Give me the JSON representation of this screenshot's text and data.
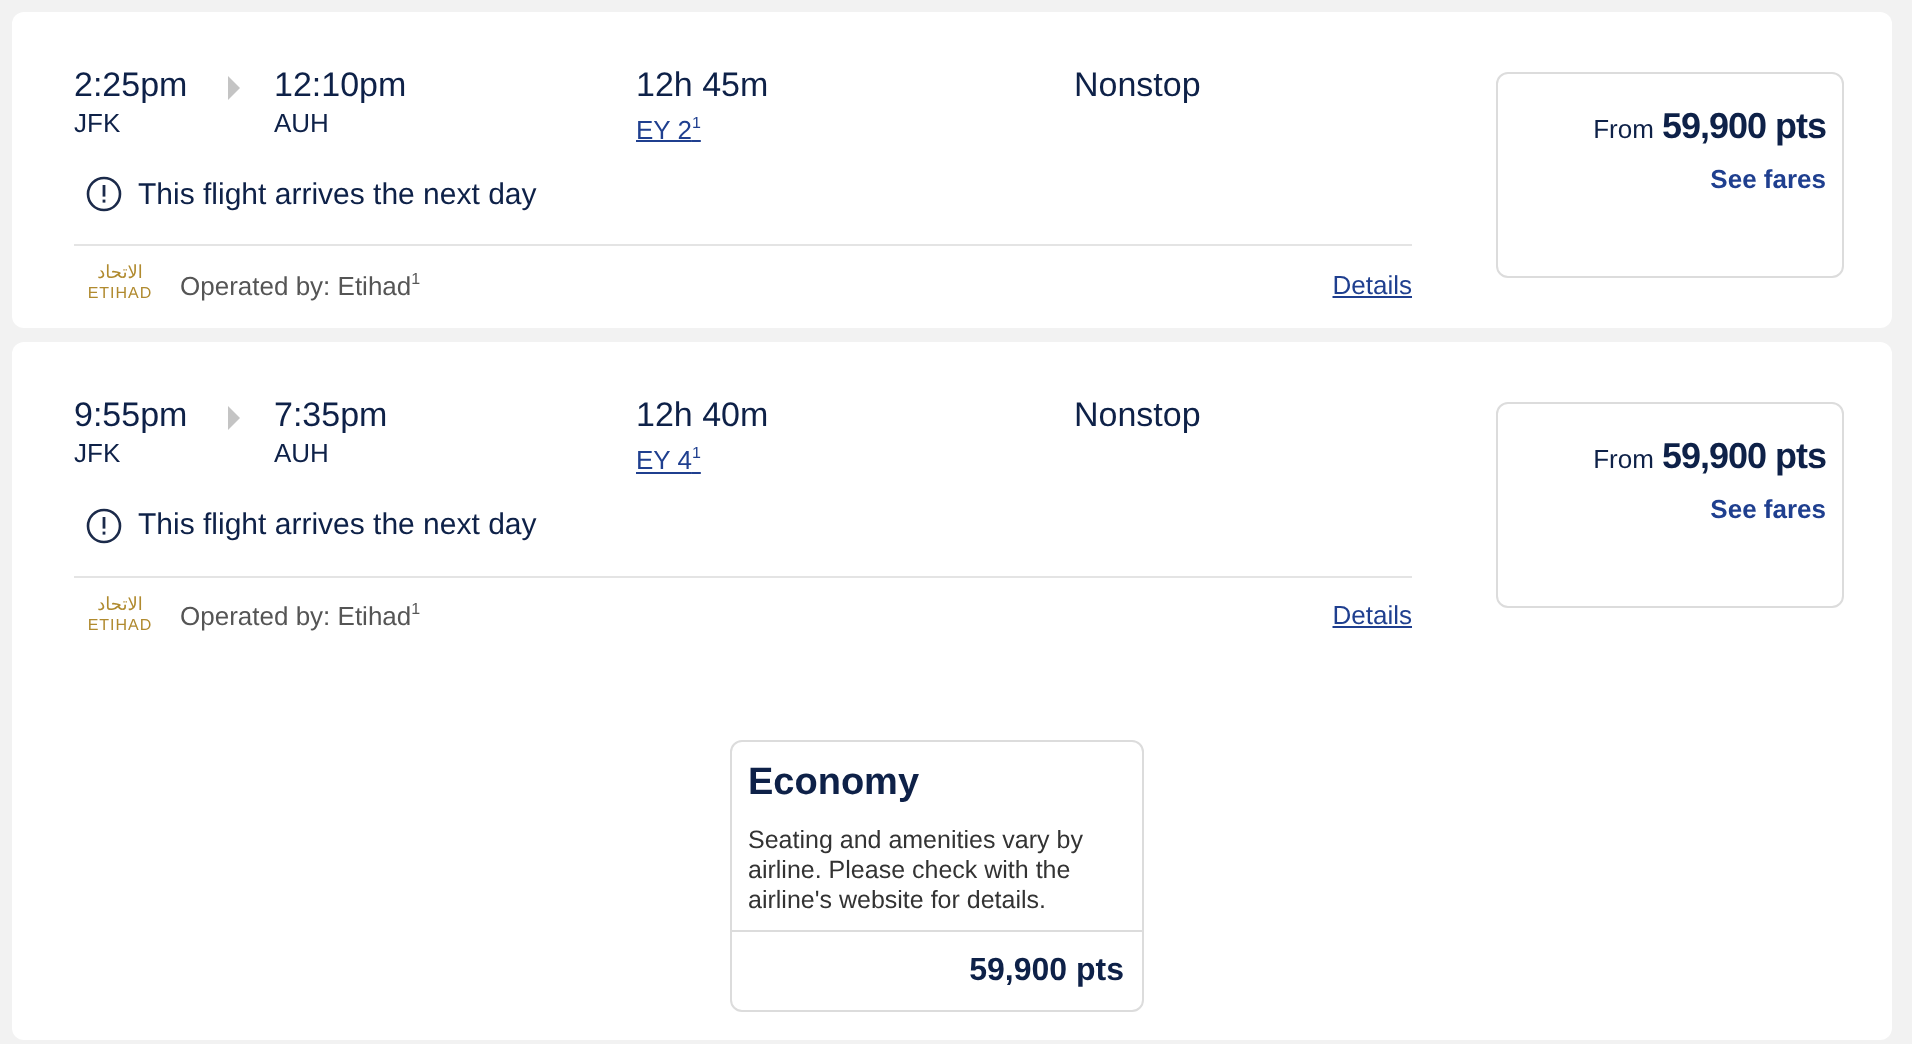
{
  "flights": [
    {
      "departure_time": "2:25pm",
      "departure_airport": "JFK",
      "arrival_time": "12:10pm",
      "arrival_airport": "AUH",
      "duration": "12h 45m",
      "flight_number": "EY 2$^{1}$",
      "stops": "Nonstop",
      "notice": "This flight arrives the next day",
      "logo": {
        "arabic": "الاتحاد",
        "latin": "ETIHAD"
      },
      "operator": "Operated by: Etihad$^{1}$",
      "details_link": "Details",
      "price_prefix": "From",
      "price": "59,900 pts",
      "see_fares": "See fares"
    },
    {
      "departure_time": "9:55pm",
      "departure_airport": "JFK",
      "arrival_time": "7:35pm",
      "arrival_airport": "AUH",
      "duration": "12h 40m",
      "flight_number": "EY 4$^{1}$",
      "stops": "Nonstop",
      "notice": "This flight arrives the next day",
      "logo": {
        "arabic": "الاتحاد",
        "latin": "ETIHAD"
      },
      "operator": "Operated by: Etihad$^{1}$",
      "details_link": "Details",
      "price_prefix": "From",
      "price": "59,900 pts",
      "see_fares": "See fares",
      "fares": [
        {
          "name": "Economy",
          "description": "Seating and amenities vary by airline. Please check with the airline's website for details.",
          "price": "59,900 pts"
        }
      ]
    }
  ]
}
